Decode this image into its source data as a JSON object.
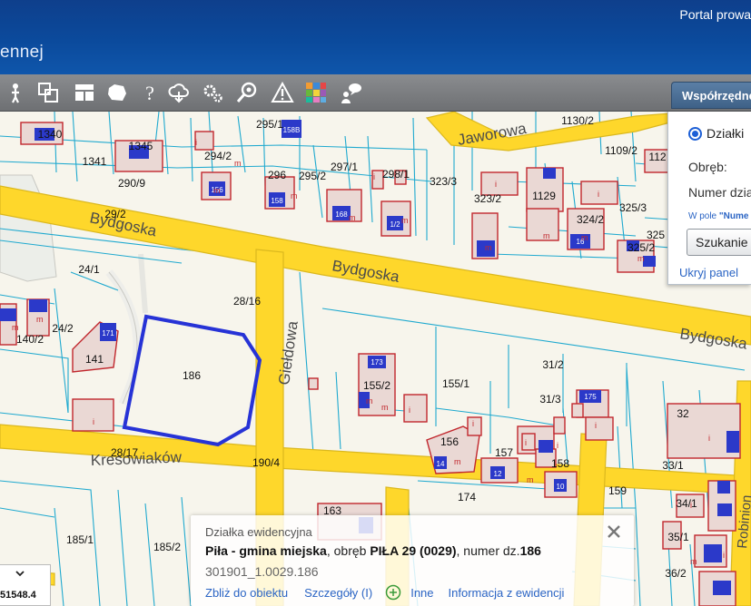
{
  "header": {
    "brand_text": "ennej",
    "portal_text": "Portal prowa"
  },
  "toolbar": {
    "buttons": [
      {
        "icon": "person-pin-icon"
      },
      {
        "icon": "layers-compare-icon"
      },
      {
        "icon": "layout-icon"
      },
      {
        "icon": "map-shape-icon"
      },
      {
        "icon": "help-icon"
      },
      {
        "icon": "cloud-download-icon"
      },
      {
        "icon": "settings-icon"
      },
      {
        "icon": "search-zoom-icon"
      },
      {
        "icon": "warning-icon"
      },
      {
        "icon": "color-palette-icon"
      },
      {
        "icon": "comment-user-icon"
      }
    ]
  },
  "panel": {
    "tab_label": "Współrzędne",
    "radio_label": "Działki",
    "obreb_label": "Obręb:",
    "numer_label": "Numer dzia",
    "hint_prefix": "W pole ",
    "hint_bold": "\"Nume",
    "search_button": "Szukanie",
    "hide_link": "Ukryj panel"
  },
  "map": {
    "streets": [
      "Jaworowa",
      "Bydgoska",
      "Bydgoska",
      "Bydgoska",
      "Giełdowa",
      "Kresowiaków",
      "Robinion"
    ],
    "parcel_labels": [
      "1340",
      "1345",
      "1341",
      "290/9",
      "295/1",
      "294/2",
      "296",
      "295/2",
      "297/1",
      "298/1",
      "323/3",
      "1130/2",
      "1109/2",
      "112",
      "323/2",
      "1129",
      "324/2",
      "325/3",
      "325",
      "325/2",
      "29/2",
      "24/1",
      "28/16",
      "140/2",
      "24/2",
      "141",
      "186",
      "155/2",
      "155/1",
      "31/2",
      "31/3",
      "32",
      "156",
      "157",
      "158",
      "33/1",
      "28/17",
      "190/4",
      "174",
      "159",
      "34/1",
      "35/1",
      "36/2",
      "185/1",
      "185/2",
      "163"
    ],
    "building_numbers": [
      "158B",
      "156",
      "158",
      "168",
      "1/2",
      "171",
      "173",
      "175",
      "14",
      "12",
      "10",
      "16"
    ],
    "colors": {
      "road_fill": "#fed72b",
      "road_edge": "#dbb81e",
      "parcel_line": "#1fa9cf",
      "building_line": "#c1272d",
      "selected_parcel": "#2733d6",
      "building_blue": "#2b39c9"
    }
  },
  "popup": {
    "title": "Działka ewidencyjna",
    "place_bold": "Piła - gmina miejska",
    "place_mid": ", obręb ",
    "obreb_bold": "PIŁA 29 (0029)",
    "number_mid": ", numer dz.",
    "number_bold": "186",
    "parcel_id": "301901_1.0029.186",
    "link_zoom": "Zbliż do obiektu",
    "link_details": "Szczegóły (I)",
    "link_other": "Inne",
    "link_info": "Informacja z ewidencji"
  },
  "coords": {
    "value": "51548.4"
  }
}
